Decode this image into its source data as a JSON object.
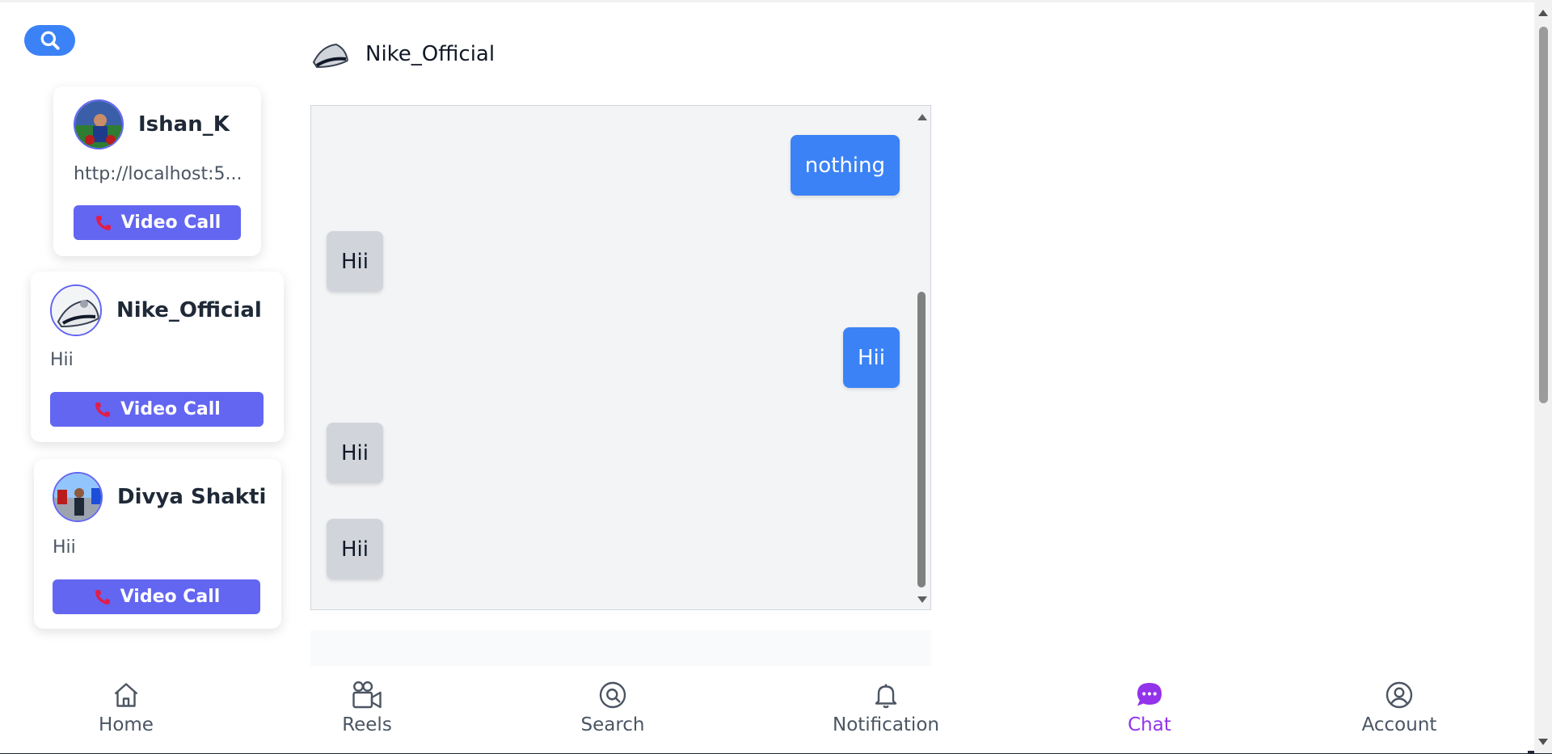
{
  "contacts": [
    {
      "name": "Ishan_K",
      "last_message": "http://localhost:5...",
      "button": "Video Call"
    },
    {
      "name": "Nike_Official",
      "last_message": "Hii",
      "button": "Video Call"
    },
    {
      "name": "Divya Shakti",
      "last_message": "Hii",
      "button": "Video Call"
    }
  ],
  "chat": {
    "contact_name": "Nike_Official",
    "messages": [
      {
        "text": "nothing",
        "direction": "outgoing"
      },
      {
        "text": "Hii",
        "direction": "incoming"
      },
      {
        "text": "Hii",
        "direction": "outgoing"
      },
      {
        "text": "Hii",
        "direction": "incoming"
      },
      {
        "text": "Hii",
        "direction": "incoming"
      }
    ]
  },
  "nav": {
    "items": [
      {
        "label": "Home",
        "icon": "home-icon"
      },
      {
        "label": "Reels",
        "icon": "video-camera-icon"
      },
      {
        "label": "Search",
        "icon": "search-icon"
      },
      {
        "label": "Notification",
        "icon": "bell-icon"
      },
      {
        "label": "Chat",
        "icon": "chat-bubble-icon",
        "active": true
      },
      {
        "label": "Account",
        "icon": "user-circle-icon"
      }
    ]
  },
  "colors": {
    "accent_blue": "#3b82f6",
    "button_indigo": "#6366f1",
    "active_purple": "#9333ea",
    "incoming_bubble": "#d1d5db"
  }
}
